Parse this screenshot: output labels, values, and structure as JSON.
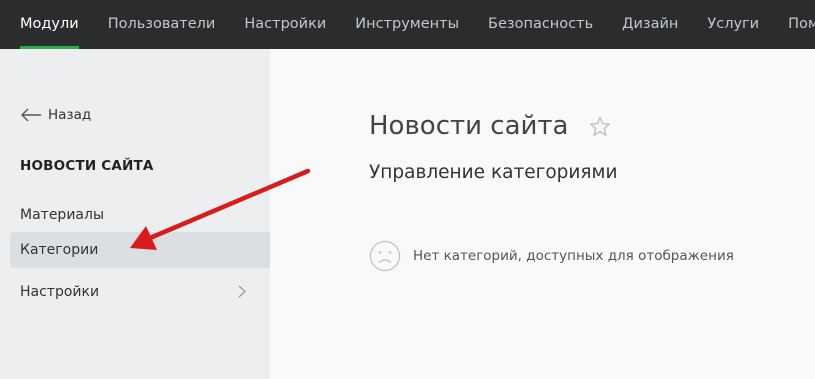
{
  "topnav": {
    "items": [
      {
        "label": "Модули",
        "active": true
      },
      {
        "label": "Пользователи"
      },
      {
        "label": "Настройки"
      },
      {
        "label": "Инструменты"
      },
      {
        "label": "Безопасность"
      },
      {
        "label": "Дизайн"
      },
      {
        "label": "Услуги"
      },
      {
        "label": "Помощь"
      }
    ]
  },
  "sidebar": {
    "back_label": "Назад",
    "section_title": "НОВОСТИ САЙТА",
    "items": [
      {
        "label": "Материалы"
      },
      {
        "label": "Категории",
        "active": true
      },
      {
        "label": "Настройки",
        "has_submenu": true
      }
    ]
  },
  "main": {
    "title": "Новости сайта",
    "subtitle": "Управление категориями",
    "empty_message": "Нет категорий, доступных для отображения"
  },
  "colors": {
    "topbar_bg": "#2a2c2e",
    "accent_green": "#26b04a",
    "annotation_arrow": "#d81b1b"
  },
  "icons": {
    "back": "arrow-left-icon",
    "favorite": "star-outline-icon",
    "empty": "sad-face-icon",
    "submenu": "chevron-right-icon"
  }
}
